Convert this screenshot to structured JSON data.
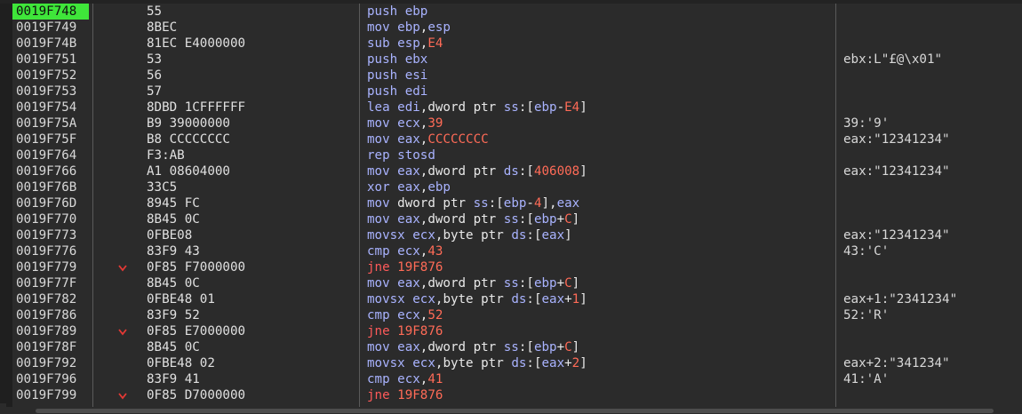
{
  "rows": [
    {
      "addr": "0019F748",
      "bytes": "55",
      "jump": false,
      "selected": true,
      "tokens": [
        [
          "mnem",
          "push"
        ],
        [
          "reg",
          "ebp"
        ]
      ],
      "comment": ""
    },
    {
      "addr": "0019F749",
      "bytes": "8BEC",
      "jump": false,
      "tokens": [
        [
          "mnem",
          "mov"
        ],
        [
          "reg",
          "ebp"
        ],
        [
          "punc",
          ","
        ],
        [
          "reg",
          "esp"
        ]
      ],
      "comment": ""
    },
    {
      "addr": "0019F74B",
      "bytes": "81EC E4000000",
      "jump": false,
      "tokens": [
        [
          "mnem",
          "sub"
        ],
        [
          "reg",
          "esp"
        ],
        [
          "punc",
          ","
        ],
        [
          "num",
          "E4"
        ]
      ],
      "comment": ""
    },
    {
      "addr": "0019F751",
      "bytes": "53",
      "jump": false,
      "tokens": [
        [
          "mnem",
          "push"
        ],
        [
          "reg",
          "ebx"
        ]
      ],
      "comment": "ebx:L\"£@\\x01\""
    },
    {
      "addr": "0019F752",
      "bytes": "56",
      "jump": false,
      "tokens": [
        [
          "mnem",
          "push"
        ],
        [
          "reg",
          "esi"
        ]
      ],
      "comment": ""
    },
    {
      "addr": "0019F753",
      "bytes": "57",
      "jump": false,
      "tokens": [
        [
          "mnem",
          "push"
        ],
        [
          "reg",
          "edi"
        ]
      ],
      "comment": ""
    },
    {
      "addr": "0019F754",
      "bytes": "8DBD 1CFFFFFF",
      "jump": false,
      "tokens": [
        [
          "mnem",
          "lea"
        ],
        [
          "reg",
          "edi"
        ],
        [
          "punc",
          ","
        ],
        [
          "kw",
          "dword ptr "
        ],
        [
          "seg",
          "ss"
        ],
        [
          "punc",
          ":["
        ],
        [
          "reg",
          "ebp"
        ],
        [
          "punc",
          "-"
        ],
        [
          "num",
          "E4"
        ],
        [
          "punc",
          "]"
        ]
      ],
      "comment": ""
    },
    {
      "addr": "0019F75A",
      "bytes": "B9 39000000",
      "jump": false,
      "tokens": [
        [
          "mnem",
          "mov"
        ],
        [
          "reg",
          "ecx"
        ],
        [
          "punc",
          ","
        ],
        [
          "num",
          "39"
        ]
      ],
      "comment": "39:'9'"
    },
    {
      "addr": "0019F75F",
      "bytes": "B8 CCCCCCCC",
      "jump": false,
      "tokens": [
        [
          "mnem",
          "mov"
        ],
        [
          "reg",
          "eax"
        ],
        [
          "punc",
          ","
        ],
        [
          "num",
          "CCCCCCCC"
        ]
      ],
      "comment": "eax:\"12341234\""
    },
    {
      "addr": "0019F764",
      "bytes": "F3:AB",
      "jump": false,
      "tokens": [
        [
          "mnem",
          "rep stosd"
        ]
      ],
      "comment": ""
    },
    {
      "addr": "0019F766",
      "bytes": "A1 08604000",
      "jump": false,
      "tokens": [
        [
          "mnem",
          "mov"
        ],
        [
          "reg",
          "eax"
        ],
        [
          "punc",
          ","
        ],
        [
          "kw",
          "dword ptr "
        ],
        [
          "seg",
          "ds"
        ],
        [
          "punc",
          ":["
        ],
        [
          "num",
          "406008"
        ],
        [
          "punc",
          "]"
        ]
      ],
      "comment": "eax:\"12341234\""
    },
    {
      "addr": "0019F76B",
      "bytes": "33C5",
      "jump": false,
      "tokens": [
        [
          "mnem",
          "xor"
        ],
        [
          "reg",
          "eax"
        ],
        [
          "punc",
          ","
        ],
        [
          "reg",
          "ebp"
        ]
      ],
      "comment": ""
    },
    {
      "addr": "0019F76D",
      "bytes": "8945 FC",
      "jump": false,
      "tokens": [
        [
          "mnem",
          "mov"
        ],
        [
          "kw",
          "dword ptr "
        ],
        [
          "seg",
          "ss"
        ],
        [
          "punc",
          ":["
        ],
        [
          "reg",
          "ebp"
        ],
        [
          "punc",
          "-"
        ],
        [
          "num",
          "4"
        ],
        [
          "punc",
          "],"
        ],
        [
          "reg",
          "eax"
        ]
      ],
      "comment": ""
    },
    {
      "addr": "0019F770",
      "bytes": "8B45 0C",
      "jump": false,
      "tokens": [
        [
          "mnem",
          "mov"
        ],
        [
          "reg",
          "eax"
        ],
        [
          "punc",
          ","
        ],
        [
          "kw",
          "dword ptr "
        ],
        [
          "seg",
          "ss"
        ],
        [
          "punc",
          ":["
        ],
        [
          "reg",
          "ebp"
        ],
        [
          "punc",
          "+"
        ],
        [
          "num",
          "C"
        ],
        [
          "punc",
          "]"
        ]
      ],
      "comment": ""
    },
    {
      "addr": "0019F773",
      "bytes": "0FBE08",
      "jump": false,
      "tokens": [
        [
          "mnem",
          "movsx"
        ],
        [
          "reg",
          "ecx"
        ],
        [
          "punc",
          ","
        ],
        [
          "kw",
          "byte ptr "
        ],
        [
          "seg",
          "ds"
        ],
        [
          "punc",
          ":["
        ],
        [
          "reg",
          "eax"
        ],
        [
          "punc",
          "]"
        ]
      ],
      "comment": "eax:\"12341234\""
    },
    {
      "addr": "0019F776",
      "bytes": "83F9 43",
      "jump": false,
      "tokens": [
        [
          "mnem",
          "cmp"
        ],
        [
          "reg",
          "ecx"
        ],
        [
          "punc",
          ","
        ],
        [
          "num",
          "43"
        ]
      ],
      "comment": "43:'C'"
    },
    {
      "addr": "0019F779",
      "bytes": "0F85 F7000000",
      "jump": true,
      "tokens": [
        [
          "jump",
          "jne"
        ],
        [
          "num",
          "19F876"
        ]
      ],
      "comment": ""
    },
    {
      "addr": "0019F77F",
      "bytes": "8B45 0C",
      "jump": false,
      "tokens": [
        [
          "mnem",
          "mov"
        ],
        [
          "reg",
          "eax"
        ],
        [
          "punc",
          ","
        ],
        [
          "kw",
          "dword ptr "
        ],
        [
          "seg",
          "ss"
        ],
        [
          "punc",
          ":["
        ],
        [
          "reg",
          "ebp"
        ],
        [
          "punc",
          "+"
        ],
        [
          "num",
          "C"
        ],
        [
          "punc",
          "]"
        ]
      ],
      "comment": ""
    },
    {
      "addr": "0019F782",
      "bytes": "0FBE48 01",
      "jump": false,
      "tokens": [
        [
          "mnem",
          "movsx"
        ],
        [
          "reg",
          "ecx"
        ],
        [
          "punc",
          ","
        ],
        [
          "kw",
          "byte ptr "
        ],
        [
          "seg",
          "ds"
        ],
        [
          "punc",
          ":["
        ],
        [
          "reg",
          "eax"
        ],
        [
          "punc",
          "+"
        ],
        [
          "num",
          "1"
        ],
        [
          "punc",
          "]"
        ]
      ],
      "comment": "eax+1:\"2341234\""
    },
    {
      "addr": "0019F786",
      "bytes": "83F9 52",
      "jump": false,
      "tokens": [
        [
          "mnem",
          "cmp"
        ],
        [
          "reg",
          "ecx"
        ],
        [
          "punc",
          ","
        ],
        [
          "num",
          "52"
        ]
      ],
      "comment": "52:'R'"
    },
    {
      "addr": "0019F789",
      "bytes": "0F85 E7000000",
      "jump": true,
      "tokens": [
        [
          "jump",
          "jne"
        ],
        [
          "num",
          "19F876"
        ]
      ],
      "comment": ""
    },
    {
      "addr": "0019F78F",
      "bytes": "8B45 0C",
      "jump": false,
      "tokens": [
        [
          "mnem",
          "mov"
        ],
        [
          "reg",
          "eax"
        ],
        [
          "punc",
          ","
        ],
        [
          "kw",
          "dword ptr "
        ],
        [
          "seg",
          "ss"
        ],
        [
          "punc",
          ":["
        ],
        [
          "reg",
          "ebp"
        ],
        [
          "punc",
          "+"
        ],
        [
          "num",
          "C"
        ],
        [
          "punc",
          "]"
        ]
      ],
      "comment": ""
    },
    {
      "addr": "0019F792",
      "bytes": "0FBE48 02",
      "jump": false,
      "tokens": [
        [
          "mnem",
          "movsx"
        ],
        [
          "reg",
          "ecx"
        ],
        [
          "punc",
          ","
        ],
        [
          "kw",
          "byte ptr "
        ],
        [
          "seg",
          "ds"
        ],
        [
          "punc",
          ":["
        ],
        [
          "reg",
          "eax"
        ],
        [
          "punc",
          "+"
        ],
        [
          "num",
          "2"
        ],
        [
          "punc",
          "]"
        ]
      ],
      "comment": "eax+2:\"341234\""
    },
    {
      "addr": "0019F796",
      "bytes": "83F9 41",
      "jump": false,
      "tokens": [
        [
          "mnem",
          "cmp"
        ],
        [
          "reg",
          "ecx"
        ],
        [
          "punc",
          ","
        ],
        [
          "num",
          "41"
        ]
      ],
      "comment": "41:'A'"
    },
    {
      "addr": "0019F799",
      "bytes": "0F85 D7000000",
      "jump": true,
      "tokens": [
        [
          "jump",
          "jne"
        ],
        [
          "num",
          "19F876"
        ]
      ],
      "comment": ""
    }
  ],
  "icons": {
    "jump_arrow": "chevron-down-icon"
  },
  "colors": {
    "background": "#2b2b2b",
    "selected_address": "#3fe63a",
    "mnemonic": "#a9b3ff",
    "register": "#a9b3ff",
    "immediate": "#ff6b57",
    "jump_mnemonic": "#ff5a5a"
  }
}
